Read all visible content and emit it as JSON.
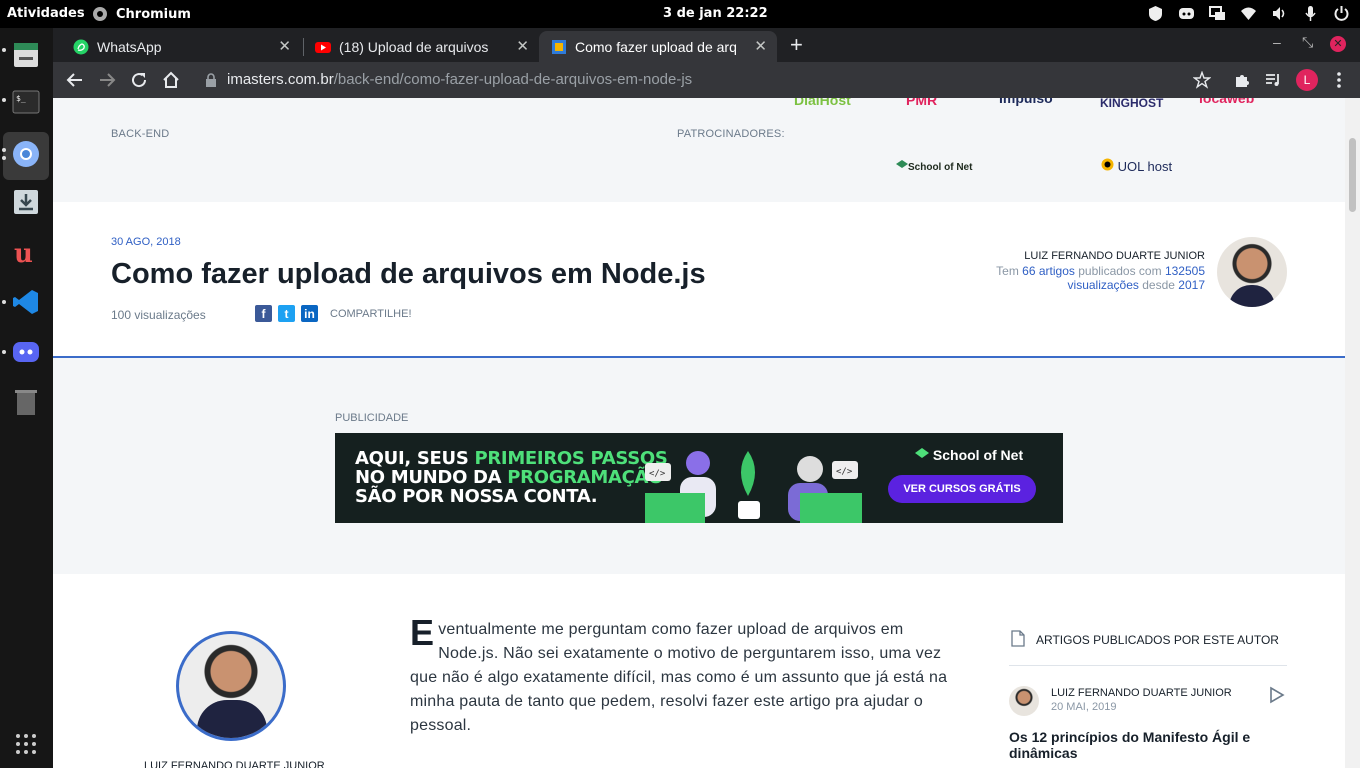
{
  "topbar": {
    "activities": "Atividades",
    "app": "Chromium",
    "clock": "3 de jan  22:22"
  },
  "tabs": [
    {
      "label": "WhatsApp"
    },
    {
      "label": "(18) Upload de arquivos"
    },
    {
      "label": "Como fazer upload de arq"
    }
  ],
  "url": {
    "host": "imasters.com.br",
    "path": "/back-end/como-fazer-upload-de-arquivos-em-node-js"
  },
  "profile_initial": "L",
  "header": {
    "category": "BACK-END",
    "sponsors_label": "PATROCINADORES:",
    "sponsors": [
      "DialHost",
      "PMR",
      "Impulso",
      "KINGHOST",
      "locaweb",
      "School of Net",
      "UOL host"
    ]
  },
  "article": {
    "date": "30 AGO, 2018",
    "title": "Como fazer upload de arquivos em Node.js",
    "views": "100 visualizações",
    "share_label": "COMPARTILHE!",
    "author": "LUIZ FERNANDO DUARTE JUNIOR",
    "meta_prefix": "Tem",
    "meta_articles": "66 artigos",
    "meta_mid": "publicados com",
    "meta_views": "132505",
    "meta_views_label": "visualizações",
    "meta_since": "desde",
    "meta_year": "2017"
  },
  "ad": {
    "label": "PUBLICIDADE",
    "line1a": "AQUI, SEUS ",
    "line1b": "PRIMEIROS PASSOS",
    "line2a": "NO MUNDO DA ",
    "line2b": "PROGRAMAÇÃO",
    "line3": "SÃO POR NOSSA CONTA.",
    "brand": "School of Net",
    "cta": "VER CURSOS GRÁTIS"
  },
  "content": {
    "author": "LUIZ FERNANDO DUARTE JUNIOR",
    "dropcap": "E",
    "text": "ventualmente me perguntam como fazer upload de arquivos em Node.js. Não sei exatamente o motivo de perguntarem isso, uma vez que não é algo exatamente difícil, mas como é um assunto que já está na minha pauta de tanto que pedem, resolvi fazer este artigo pra ajudar o pessoal.",
    "sidebar_heading": "ARTIGOS PUBLICADOS POR ESTE AUTOR",
    "side_author": "LUIZ FERNANDO DUARTE JUNIOR",
    "side_date": "20 MAI, 2019",
    "side_title": "Os 12 princípios do Manifesto Ágil e dinâmicas"
  },
  "colors": {
    "accent": "#3b6cc9",
    "link": "#2f5fc4",
    "ad_green": "#4ee07a",
    "ad_cta": "#5b22e0"
  }
}
